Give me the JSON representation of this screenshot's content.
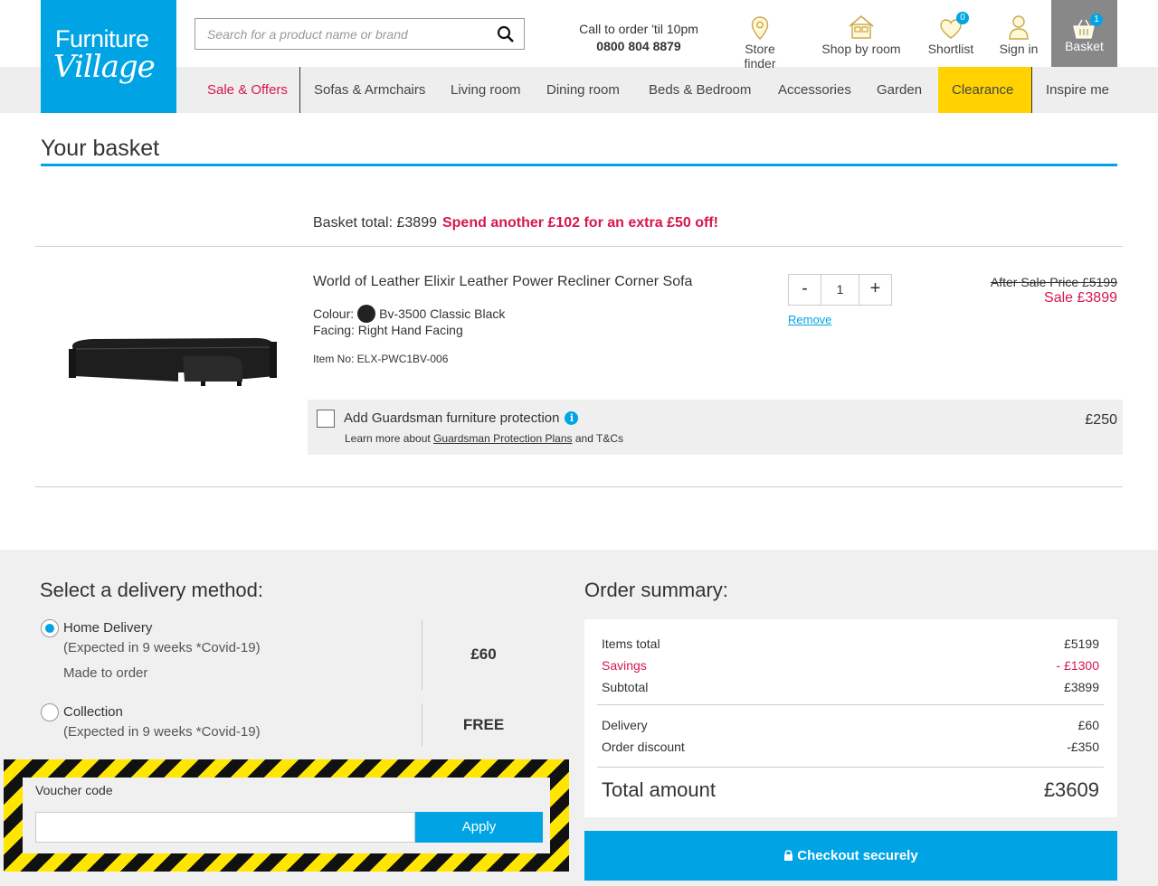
{
  "brand": {
    "line1": "Furniture",
    "line2": "Village"
  },
  "search": {
    "placeholder": "Search for a product name or brand"
  },
  "call": {
    "text": "Call to order 'til 10pm",
    "number": "0800 804 8879"
  },
  "header_links": {
    "store_finder": "Store finder",
    "shop_by_room": "Shop by room",
    "shortlist": "Shortlist",
    "shortlist_count": "0",
    "sign_in": "Sign in",
    "basket": "Basket",
    "basket_count": "1"
  },
  "nav": [
    "Sale & Offers",
    "Sofas & Armchairs",
    "Living room",
    "Dining room",
    "Beds & Bedroom",
    "Accessories",
    "Garden",
    "Clearance",
    "Inspire me"
  ],
  "basket": {
    "title": "Your basket",
    "total_label": "Basket total: £3899",
    "promo": "Spend another £102 for an extra £50 off!"
  },
  "product": {
    "name": "World of Leather Elixir Leather Power Recliner Corner Sofa",
    "colour_label": "Colour:",
    "colour_value": "Bv-3500 Classic Black",
    "facing": "Facing: Right Hand Facing",
    "item_no": "Item No: ELX-PWC1BV-006",
    "quantity": "1",
    "qty_minus": "-",
    "qty_plus": "+",
    "remove": "Remove",
    "after_sale_price": "After Sale Price £5199",
    "sale_price": "Sale £3899"
  },
  "guardsman": {
    "title": "Add Guardsman furniture protection",
    "learn_prefix": "Learn more about",
    "learn_link": "Guardsman Protection Plans",
    "learn_suffix": "and T&Cs",
    "price": "£250",
    "info_glyph": "i"
  },
  "delivery": {
    "title": "Select a delivery method:",
    "options": [
      {
        "label": "Home Delivery",
        "sub1": "(Expected in 9 weeks *Covid-19)",
        "sub2": "Made to order",
        "price": "£60"
      },
      {
        "label": "Collection",
        "sub1": "(Expected in 9 weeks *Covid-19)",
        "price": "FREE"
      }
    ]
  },
  "voucher": {
    "label": "Voucher code",
    "value": "",
    "apply": "Apply"
  },
  "summary": {
    "title": "Order summary:",
    "items_total_label": "Items total",
    "items_total": "£5199",
    "savings_label": "Savings",
    "savings": "- £1300",
    "subtotal_label": "Subtotal",
    "subtotal": "£3899",
    "delivery_label": "Delivery",
    "delivery": "£60",
    "discount_label": "Order discount",
    "discount": "-£350",
    "total_label": "Total amount",
    "total": "£3609"
  },
  "checkout": {
    "label": "Checkout securely"
  },
  "colors": {
    "brand_blue": "#00a4e4",
    "sale_red": "#d6174d",
    "clearance_yellow": "#ffd200"
  }
}
